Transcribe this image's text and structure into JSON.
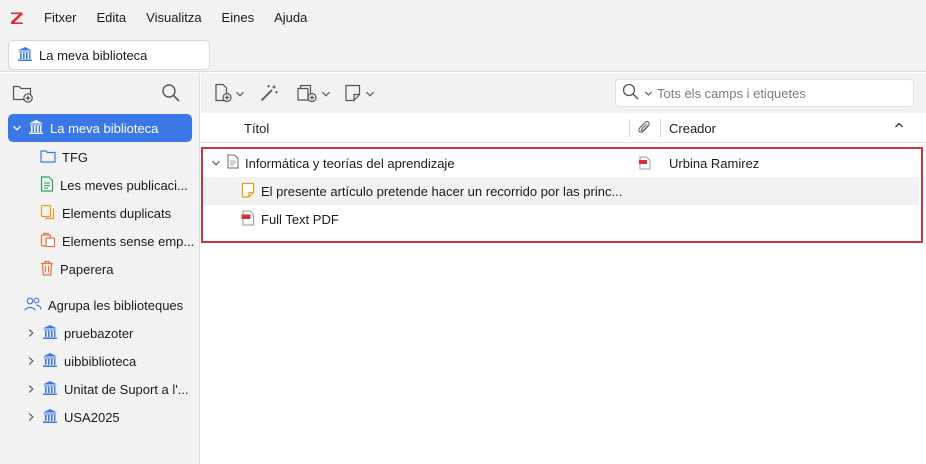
{
  "app": {
    "logo_letter": "Z",
    "brand_color": "#db2c3a"
  },
  "menu": [
    "Fitxer",
    "Edita",
    "Visualitza",
    "Eines",
    "Ajuda"
  ],
  "tab": {
    "label": "La meva biblioteca",
    "icon": "library-icon"
  },
  "sidebar": {
    "my_library": {
      "label": "La meva biblioteca",
      "selected": true
    },
    "collections": [
      {
        "label": "TFG",
        "icon": "folder-icon"
      },
      {
        "label": "Les meves publicaci...",
        "icon": "my-publications-icon"
      },
      {
        "label": "Elements duplicats",
        "icon": "duplicates-icon"
      },
      {
        "label": "Elements sense emp...",
        "icon": "unfiled-icon"
      },
      {
        "label": "Paperera",
        "icon": "trash-icon"
      }
    ],
    "group_header": "Agrupa les biblioteques",
    "groups": [
      {
        "label": "pruebazoter"
      },
      {
        "label": "uibbiblioteca"
      },
      {
        "label": "Unitat de Suport a l'..."
      },
      {
        "label": "USA2025"
      }
    ]
  },
  "toolbar": {
    "search_placeholder": "Tots els camps i etiquetes",
    "search_value": ""
  },
  "columns": {
    "title": "Títol",
    "creator": "Creador"
  },
  "items": [
    {
      "title": "Informática y teorías del aprendizaje",
      "creator": "Urbina Ramirez",
      "type": "document-icon",
      "has_pdf": true
    },
    {
      "title": "El presente artículo pretende hacer un recorrido por las princ...",
      "type": "note-icon"
    },
    {
      "title": "Full Text PDF",
      "type": "pdf-icon"
    }
  ],
  "colors": {
    "selection": "#3b78e7",
    "highlight_border": "#cc3340",
    "chrome": "#f2f2f2"
  }
}
